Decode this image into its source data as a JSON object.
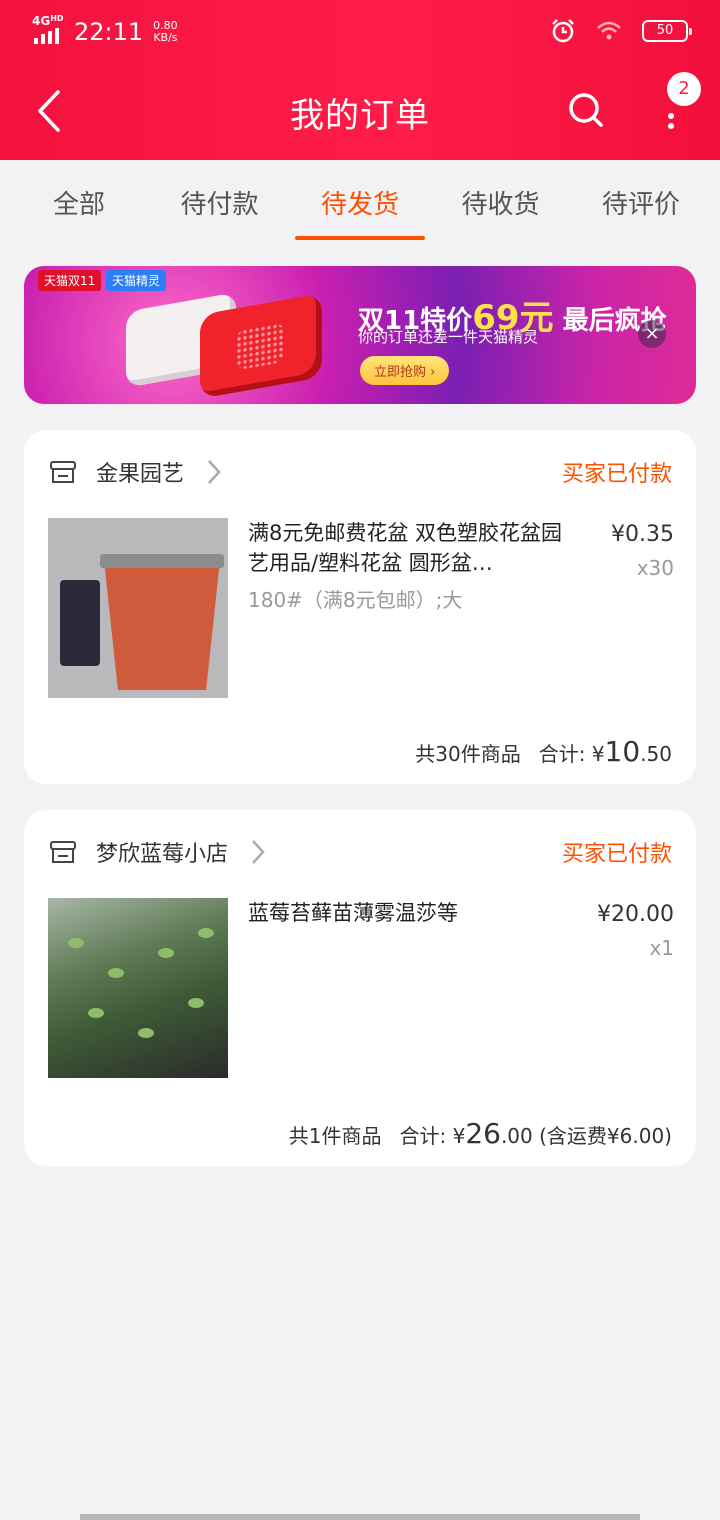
{
  "statusbar": {
    "network": "4G",
    "network_suffix": "HD",
    "time": "22:11",
    "speed_value": "0.80",
    "speed_unit": "KB/s",
    "battery": "50"
  },
  "nav": {
    "title": "我的订单",
    "more_badge": "2"
  },
  "tabs": [
    {
      "label": "全部"
    },
    {
      "label": "待付款"
    },
    {
      "label": "待发货",
      "active": true
    },
    {
      "label": "待收货"
    },
    {
      "label": "待评价"
    }
  ],
  "banner": {
    "tag1": "天猫双11",
    "tag2": "天猫精灵",
    "title_prefix": "双11特价",
    "title_price": "69元",
    "title_suffix": "最后疯抢",
    "subtitle": "你的订单还差一件天猫精灵",
    "button": "立即抢购",
    "close_symbol": "×"
  },
  "orders": [
    {
      "shop": "金果园艺",
      "status": "买家已付款",
      "item_name": "满8元免邮费花盆 双色塑胶花盆园艺用品/塑料花盆 圆形盆…",
      "sku": "180#（满8元包邮）;大",
      "price": "¥0.35",
      "qty": "x30",
      "count_text": "共30件商品",
      "total_label": "合计:",
      "total_symbol": "¥",
      "total_int": "10",
      "total_dec": ".50",
      "shipping_note": ""
    },
    {
      "shop": "梦欣蓝莓小店",
      "status": "买家已付款",
      "item_name": "蓝莓苔藓苗薄雾温莎等",
      "sku": "",
      "price": "¥20.00",
      "qty": "x1",
      "count_text": "共1件商品",
      "total_label": "合计:",
      "total_symbol": "¥",
      "total_int": "26",
      "total_dec": ".00",
      "shipping_note": "(含运费¥6.00)"
    }
  ],
  "colors": {
    "header": "#ff1c48",
    "accent": "#ff5000"
  }
}
